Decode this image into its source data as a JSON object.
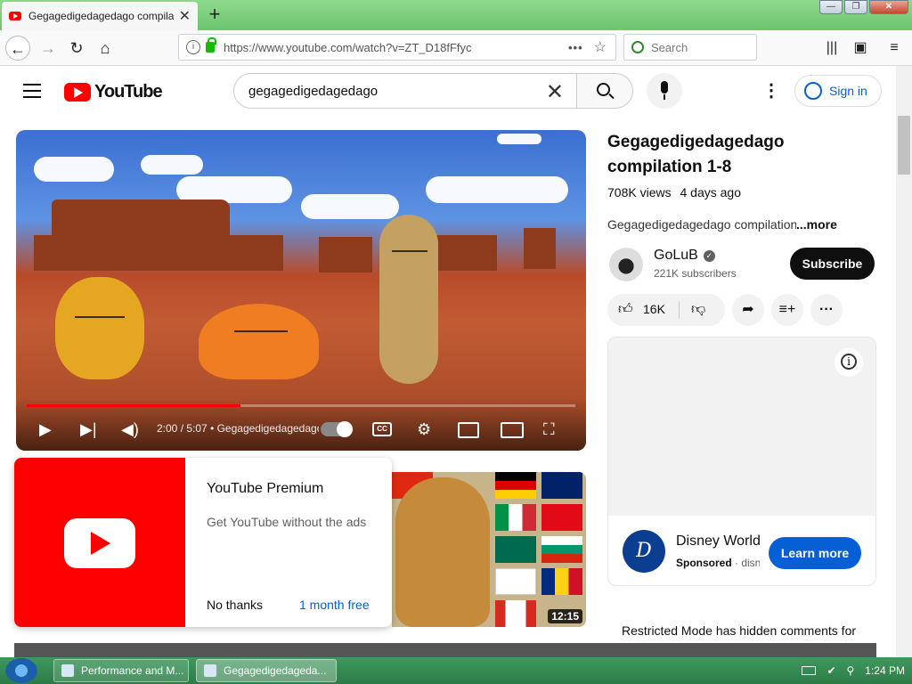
{
  "browser": {
    "tab_title": "Gegagedigedagedago compilati",
    "tab_close": "✕",
    "new_tab": "+",
    "url": "https://www.youtube.com/watch?v=ZT_D18fFfyc",
    "url_info": "i",
    "url_actions": "•••",
    "bookmark_star": "☆",
    "search_placeholder": "Search",
    "window_buttons": [
      "—",
      "❐",
      "✕"
    ]
  },
  "youtube": {
    "logo_text": "YouTube",
    "search_query": "gegagedigedagedago",
    "clear_symbol": "✕",
    "more_symbol": "⋮",
    "signin_label": "Sign in"
  },
  "player": {
    "time": "2:00 / 5:07",
    "chapter": "• Gegagedigedagedago",
    "progress_fraction": 0.39,
    "cc_label": "CC"
  },
  "promo": {
    "title": "YouTube Premium",
    "description": "Get YouTube without the ads",
    "no_thanks": "No thanks",
    "month_free": "1 month free"
  },
  "thumb2": {
    "duration": "12:15"
  },
  "video": {
    "title": "Gegagedigedagedago compilation 1-8",
    "views": "708K views",
    "age": "4 days ago",
    "description": "Gegagedigedagedago compilation",
    "more": "...more",
    "channel_name": "GoLuB",
    "verified_mark": "✓",
    "subscribers": "221K subscribers",
    "subscribe_label": "Subscribe",
    "likes": "16K"
  },
  "ad": {
    "info_symbol": "i",
    "logo_letter": "D",
    "name": "Disney World",
    "sponsored": "Sponsored",
    "domain": "· disney",
    "cta": "Learn more"
  },
  "comments": {
    "restricted_notice": "Restricted Mode has hidden comments for"
  },
  "taskbar": {
    "tasks": [
      "Performance and M...",
      "Gegagedigedageda..."
    ],
    "clock": "1:24 PM"
  },
  "colors": {
    "youtube_red": "#ff0000",
    "link_blue": "#065fd4",
    "taskbar_green": "#2e7b48"
  }
}
